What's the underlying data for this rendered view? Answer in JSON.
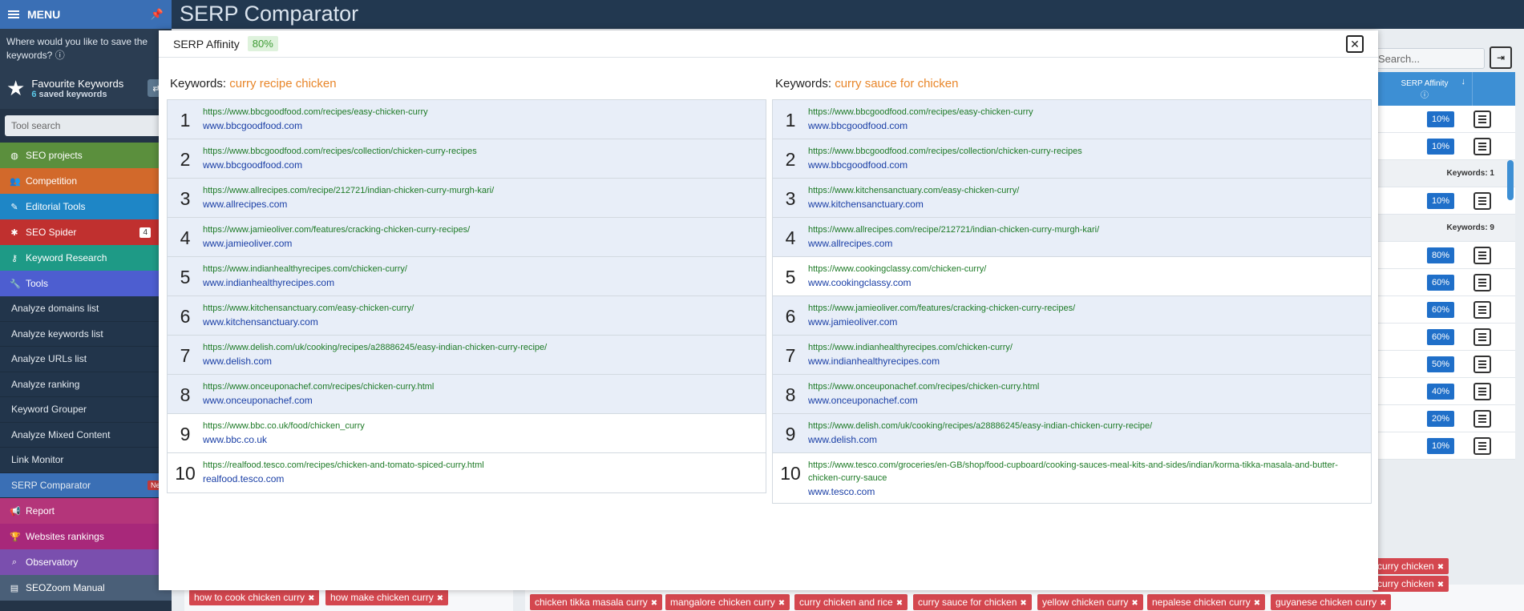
{
  "app_title": "SERP Comparator",
  "sidebar": {
    "menu_label": "MENU",
    "save_question": "Where would you like to save the keywords? ⓘ",
    "favourites_title": "Favourite Keywords",
    "favourites_count": "6",
    "favourites_suffix": "saved keywords",
    "tool_search_placeholder": "Tool search",
    "nav": [
      {
        "label": "SEO projects",
        "color": "#5b8f3d",
        "icon": "globe-icon"
      },
      {
        "label": "Competition",
        "color": "#d2692b",
        "icon": "users-icon"
      },
      {
        "label": "Editorial Tools",
        "color": "#1e86c6",
        "icon": "pencil-icon"
      },
      {
        "label": "SEO Spider",
        "color": "#c0302f",
        "icon": "bug-icon",
        "badge": "4"
      },
      {
        "label": "Keyword Research",
        "color": "#1e9a86",
        "icon": "key-icon"
      },
      {
        "label": "Tools",
        "color": "#4d5ed0",
        "icon": "wrench-icon"
      }
    ],
    "tools_sub": [
      "Analyze domains list",
      "Analyze keywords list",
      "Analyze URLs list",
      "Analyze ranking",
      "Keyword Grouper",
      "Analyze Mixed Content",
      "Link Monitor",
      "SERP Comparator"
    ],
    "new_badge": "New",
    "nav_bottom": [
      {
        "label": "Report",
        "color": "#b4357a",
        "icon": "megaphone-icon"
      },
      {
        "label": "Websites rankings",
        "color": "#a8287a",
        "icon": "trophy-icon"
      },
      {
        "label": "Observatory",
        "color": "#7a4fae",
        "icon": "telescope-icon"
      },
      {
        "label": "SEOZoom Manual",
        "color": "#4a5f78",
        "icon": "book-icon"
      }
    ]
  },
  "background": {
    "search_placeholder": "Search...",
    "affinity_header": "SERP Affinity",
    "group_labels": [
      "Keywords: 1",
      "Keywords: 9"
    ],
    "affinity_values": [
      "10%",
      "10%",
      "10%",
      "80%",
      "60%",
      "60%",
      "60%",
      "50%",
      "40%",
      "20%",
      "10%"
    ],
    "tags_bottom_left": [
      "how to cook chicken curry",
      "how make chicken curry"
    ],
    "tags_bottom_right": [
      "chicken tikka masala curry",
      "mangalore chicken curry",
      "curry chicken and rice",
      "curry sauce for chicken",
      "yellow chicken curry",
      "nepalese chicken curry",
      "guyanese chicken curry"
    ],
    "tags_right_upper": [
      "curry chicken",
      "curry chicken"
    ]
  },
  "modal": {
    "title": "SERP Affinity",
    "score": "80%",
    "keywords_prefix": "Keywords:",
    "left": {
      "keyword": "curry recipe chicken",
      "results": [
        {
          "rank": "1",
          "url": "https://www.bbcgoodfood.com/recipes/easy-chicken-curry",
          "domain": "www.bbcgoodfood.com"
        },
        {
          "rank": "2",
          "url": "https://www.bbcgoodfood.com/recipes/collection/chicken-curry-recipes",
          "domain": "www.bbcgoodfood.com"
        },
        {
          "rank": "3",
          "url": "https://www.allrecipes.com/recipe/212721/indian-chicken-curry-murgh-kari/",
          "domain": "www.allrecipes.com"
        },
        {
          "rank": "4",
          "url": "https://www.jamieoliver.com/features/cracking-chicken-curry-recipes/",
          "domain": "www.jamieoliver.com"
        },
        {
          "rank": "5",
          "url": "https://www.indianhealthyrecipes.com/chicken-curry/",
          "domain": "www.indianhealthyrecipes.com"
        },
        {
          "rank": "6",
          "url": "https://www.kitchensanctuary.com/easy-chicken-curry/",
          "domain": "www.kitchensanctuary.com"
        },
        {
          "rank": "7",
          "url": "https://www.delish.com/uk/cooking/recipes/a28886245/easy-indian-chicken-curry-recipe/",
          "domain": "www.delish.com"
        },
        {
          "rank": "8",
          "url": "https://www.onceuponachef.com/recipes/chicken-curry.html",
          "domain": "www.onceuponachef.com"
        },
        {
          "rank": "9",
          "url": "https://www.bbc.co.uk/food/chicken_curry",
          "domain": "www.bbc.co.uk"
        },
        {
          "rank": "10",
          "url": "https://realfood.tesco.com/recipes/chicken-and-tomato-spiced-curry.html",
          "domain": "realfood.tesco.com"
        }
      ]
    },
    "right": {
      "keyword": "curry sauce for chicken",
      "results": [
        {
          "rank": "1",
          "url": "https://www.bbcgoodfood.com/recipes/easy-chicken-curry",
          "domain": "www.bbcgoodfood.com"
        },
        {
          "rank": "2",
          "url": "https://www.bbcgoodfood.com/recipes/collection/chicken-curry-recipes",
          "domain": "www.bbcgoodfood.com"
        },
        {
          "rank": "3",
          "url": "https://www.kitchensanctuary.com/easy-chicken-curry/",
          "domain": "www.kitchensanctuary.com"
        },
        {
          "rank": "4",
          "url": "https://www.allrecipes.com/recipe/212721/indian-chicken-curry-murgh-kari/",
          "domain": "www.allrecipes.com"
        },
        {
          "rank": "5",
          "url": "https://www.cookingclassy.com/chicken-curry/",
          "domain": "www.cookingclassy.com"
        },
        {
          "rank": "6",
          "url": "https://www.jamieoliver.com/features/cracking-chicken-curry-recipes/",
          "domain": "www.jamieoliver.com"
        },
        {
          "rank": "7",
          "url": "https://www.indianhealthyrecipes.com/chicken-curry/",
          "domain": "www.indianhealthyrecipes.com"
        },
        {
          "rank": "8",
          "url": "https://www.onceuponachef.com/recipes/chicken-curry.html",
          "domain": "www.onceuponachef.com"
        },
        {
          "rank": "9",
          "url": "https://www.delish.com/uk/cooking/recipes/a28886245/easy-indian-chicken-curry-recipe/",
          "domain": "www.delish.com"
        },
        {
          "rank": "10",
          "url": "https://www.tesco.com/groceries/en-GB/shop/food-cupboard/cooking-sauces-meal-kits-and-sides/indian/korma-tikka-masala-and-butter-chicken-curry-sauce",
          "domain": "www.tesco.com"
        }
      ]
    }
  }
}
